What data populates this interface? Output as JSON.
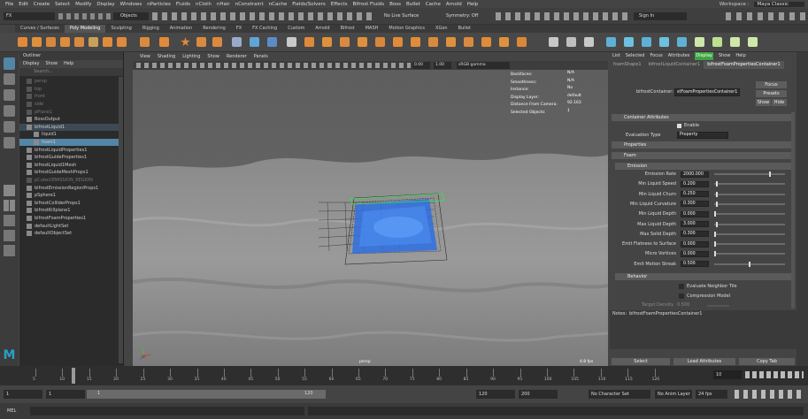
{
  "menubar": {
    "items": [
      "File",
      "Edit",
      "Create",
      "Select",
      "Modify",
      "Display",
      "Windows",
      "nParticles",
      "Fluids",
      "nCloth",
      "nHair",
      "nConstraint",
      "nCache",
      "Fields/Solvers",
      "Effects",
      "Bifrost Fluids",
      "Boss",
      "Bullet",
      "Cache",
      "Arnold",
      "Help"
    ],
    "workspace_label": "Workspace :",
    "workspace_value": "Maya Classic"
  },
  "statusline": {
    "mode": "FX",
    "objects": "Objects",
    "live_surface": "No Live Surface",
    "symmetry": "Symmetry: Off",
    "sign_in": "Sign In"
  },
  "shelf": {
    "tabs": [
      "Curves / Surfaces",
      "Poly Modeling",
      "Sculpting",
      "Rigging",
      "Animation",
      "Rendering",
      "FX",
      "FX Caching",
      "Custom",
      "Arnold",
      "Bifrost",
      "MASH",
      "Motion Graphics",
      "XGen",
      "Bullet"
    ],
    "active": "Poly Modeling"
  },
  "outliner": {
    "title": "Outliner",
    "menu": [
      "Display",
      "Show",
      "Help"
    ],
    "search_placeholder": "Search...",
    "items": [
      {
        "label": "persp",
        "indent": 0,
        "dim": true,
        "selected": false
      },
      {
        "label": "top",
        "indent": 0,
        "dim": true,
        "selected": false
      },
      {
        "label": "front",
        "indent": 0,
        "dim": true,
        "selected": false
      },
      {
        "label": "side",
        "indent": 0,
        "dim": true,
        "selected": false
      },
      {
        "label": "pPlane1",
        "indent": 0,
        "dim": true,
        "selected": false
      },
      {
        "label": "BossOutput",
        "indent": 0,
        "dim": false,
        "selected": false
      },
      {
        "label": "bifrostLiquid1",
        "indent": 0,
        "dim": false,
        "selected": false,
        "hl": true
      },
      {
        "label": "liquid1",
        "indent": 1,
        "dim": false,
        "selected": false
      },
      {
        "label": "foam1",
        "indent": 1,
        "dim": false,
        "selected": true
      },
      {
        "label": "bifrostLiquidProperties1",
        "indent": 0,
        "dim": false,
        "selected": false
      },
      {
        "label": "bifrostGuideProperties1",
        "indent": 0,
        "dim": false,
        "selected": false
      },
      {
        "label": "bifrostLiquid1Mesh",
        "indent": 0,
        "dim": false,
        "selected": false
      },
      {
        "label": "bifrostGuideMeshProps1",
        "indent": 0,
        "dim": false,
        "selected": false
      },
      {
        "label": "pCube1EMISSION_REGION",
        "indent": 0,
        "dim": true,
        "selected": false
      },
      {
        "label": "bifrostEmissionRegionProps1",
        "indent": 0,
        "dim": false,
        "selected": false
      },
      {
        "label": "pSphere1",
        "indent": 0,
        "dim": false,
        "selected": false
      },
      {
        "label": "bifrostColliderProps1",
        "indent": 0,
        "dim": false,
        "selected": false
      },
      {
        "label": "bifrostKillplane1",
        "indent": 0,
        "dim": false,
        "selected": false
      },
      {
        "label": "bifrostFoamProperties1",
        "indent": 0,
        "dim": false,
        "selected": false
      },
      {
        "label": "defaultLightSet",
        "indent": 0,
        "dim": false,
        "selected": false
      },
      {
        "label": "defaultObjectSet",
        "indent": 0,
        "dim": false,
        "selected": false
      }
    ]
  },
  "viewport": {
    "menu": [
      "View",
      "Shading",
      "Lighting",
      "Show",
      "Renderer",
      "Panels"
    ],
    "field1": "0.00",
    "field2": "1.00",
    "colorspace": "sRGB gamma",
    "hud": [
      {
        "label": "Backfaces:",
        "value": "N/A"
      },
      {
        "label": "Smoothness:",
        "value": "N/A"
      },
      {
        "label": "Instance:",
        "value": "No"
      },
      {
        "label": "Display Layer:",
        "value": "default"
      },
      {
        "label": "Distance From Camera:",
        "value": "92.163"
      },
      {
        "label": "Selected Objects:",
        "value": "1"
      }
    ],
    "camera": "persp",
    "fps": "4.8 fps"
  },
  "attribute_editor": {
    "menu": [
      "List",
      "Selected",
      "Focus",
      "Attributes",
      "Display",
      "Show",
      "Help"
    ],
    "tabs": [
      "foamShape1",
      "bifrostLiquidContainer1",
      "bifrostFoamPropertiesContainer1"
    ],
    "container_label": "bifrostContainer:",
    "container_value": "stFoamPropertiesContainer1",
    "focus": "Focus",
    "presets": "Presets",
    "show": "Show",
    "hide": "Hide",
    "container_attributes": "Container Attributes",
    "enable": "Enable",
    "evaluation_type_label": "Evaluation Type",
    "evaluation_type_value": "Property",
    "properties": "Properties",
    "foam": "Foam",
    "emission": "Emission",
    "emission_attrs": [
      {
        "label": "Emission Rate",
        "value": "2000.000",
        "level": 0.8
      },
      {
        "label": "Min Liquid Speed",
        "value": "0.200",
        "level": 0.02
      },
      {
        "label": "Min Liquid Churn",
        "value": "0.250",
        "level": 0.03
      },
      {
        "label": "Min Liquid Curvature",
        "value": "0.300",
        "level": 0.02
      },
      {
        "label": "Min Liquid Depth",
        "value": "0.000",
        "level": 0.0
      },
      {
        "label": "Max Liquid Depth",
        "value": "3.000",
        "level": 0.03
      },
      {
        "label": "Max Solid Depth",
        "value": "0.300",
        "level": 0.0
      },
      {
        "label": "Emit Flatness to Surface",
        "value": "0.000",
        "level": 0.0
      },
      {
        "label": "Micro Vortices",
        "value": "0.000",
        "level": 0.0
      },
      {
        "label": "Emit Motion Streak",
        "value": "0.500",
        "level": 0.5
      }
    ],
    "behavior": "Behavior",
    "evaluate_neighbor": "Evaluate Neighbor Tile",
    "compression": "Compression Model",
    "target_density_label": "Target Density",
    "target_density_value": "0.500",
    "notes_label": "Notes:",
    "notes_value": "bifrostFoamPropertiesContainer1",
    "select": "Select",
    "load_attributes": "Load Attributes",
    "copy_tab": "Copy Tab"
  },
  "timeline": {
    "ticks": [
      "5",
      "10",
      "15",
      "20",
      "25",
      "30",
      "35",
      "40",
      "45",
      "50",
      "55",
      "60",
      "65",
      "70",
      "75",
      "80",
      "85",
      "90",
      "95",
      "100",
      "105",
      "110",
      "115",
      "120"
    ],
    "current_frame": "10"
  },
  "range": {
    "start": "1",
    "start2": "1",
    "slider_start": "1",
    "slider_end": "120",
    "end": "120",
    "end2": "200",
    "character_set": "No Character Set",
    "anim_layer": "No Anim Layer",
    "fps": "24 fps"
  },
  "commandline": {
    "lang": "MEL"
  },
  "colors": {
    "accent_blue": "#5285a6",
    "foam_blue": "#2e6fe0",
    "display_tab": "#3fa344"
  }
}
